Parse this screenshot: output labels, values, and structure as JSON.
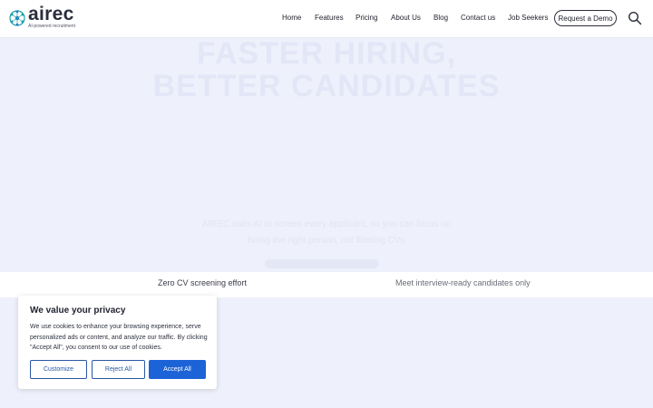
{
  "brand": {
    "name": "airec",
    "tagline": "AI-powered recruitment",
    "accent": "#1c63d8",
    "logo_colors": [
      "#1a9fb0",
      "#2a6fc9"
    ]
  },
  "nav": {
    "items": [
      "Home",
      "Features",
      "Pricing",
      "About Us",
      "Blog",
      "Contact us",
      "Job Seekers"
    ],
    "cta_label": "Request a Demo",
    "search_icon": "search-icon"
  },
  "hero": {
    "title_line1": "FASTER HIRING,",
    "title_line2": "BETTER CANDIDATES",
    "subtitle_line1": "AIREC uses AI to screen every applicant, so you can focus on",
    "subtitle_line2": "hiring the right person, not filtering CVs"
  },
  "features_strip": {
    "left": "Zero CV screening effort",
    "right": "Meet interview-ready candidates only"
  },
  "cookie_banner": {
    "title": "We value your privacy",
    "body": "We use cookies to enhance your browsing experience, serve personalized ads or content, and analyze our traffic. By clicking \"Accept All\", you consent to our use of cookies.",
    "customize_label": "Customize",
    "reject_label": "Reject All",
    "accept_label": "Accept All"
  }
}
